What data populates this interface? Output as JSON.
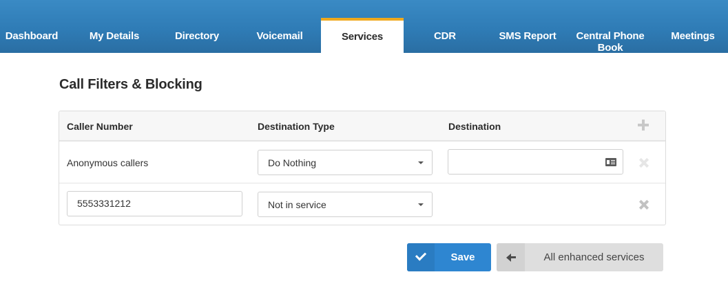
{
  "nav": {
    "tabs": [
      {
        "label": "Dashboard",
        "active": false
      },
      {
        "label": "My Details",
        "active": false
      },
      {
        "label": "Directory",
        "active": false
      },
      {
        "label": "Voicemail",
        "active": false
      },
      {
        "label": "Services",
        "active": true
      },
      {
        "label": "CDR",
        "active": false
      },
      {
        "label": "SMS Report",
        "active": false
      },
      {
        "label": "Central Phone Book",
        "active": false
      },
      {
        "label": "Meetings",
        "active": false
      }
    ],
    "accent_color": "#f0a91e",
    "bar_color": "#2f7cb6"
  },
  "page": {
    "title": "Call Filters & Blocking"
  },
  "table": {
    "headers": {
      "caller_number": "Caller Number",
      "destination_type": "Destination Type",
      "destination": "Destination"
    },
    "add_icon": "plus-icon",
    "rows": [
      {
        "caller_number": "Anonymous callers",
        "destination_type": "Do Nothing",
        "destination_value": "",
        "destination_icon": "contact-card-icon",
        "remove_icon": "remove-icon"
      },
      {
        "caller_number": "5553331212",
        "destination_type": "Not in service",
        "remove_icon": "remove-icon"
      }
    ]
  },
  "actions": {
    "save_label": "Save",
    "save_icon": "check-icon",
    "save_color": "#2e86d1",
    "back_label": "All enhanced services",
    "back_icon": "arrow-left-icon"
  }
}
